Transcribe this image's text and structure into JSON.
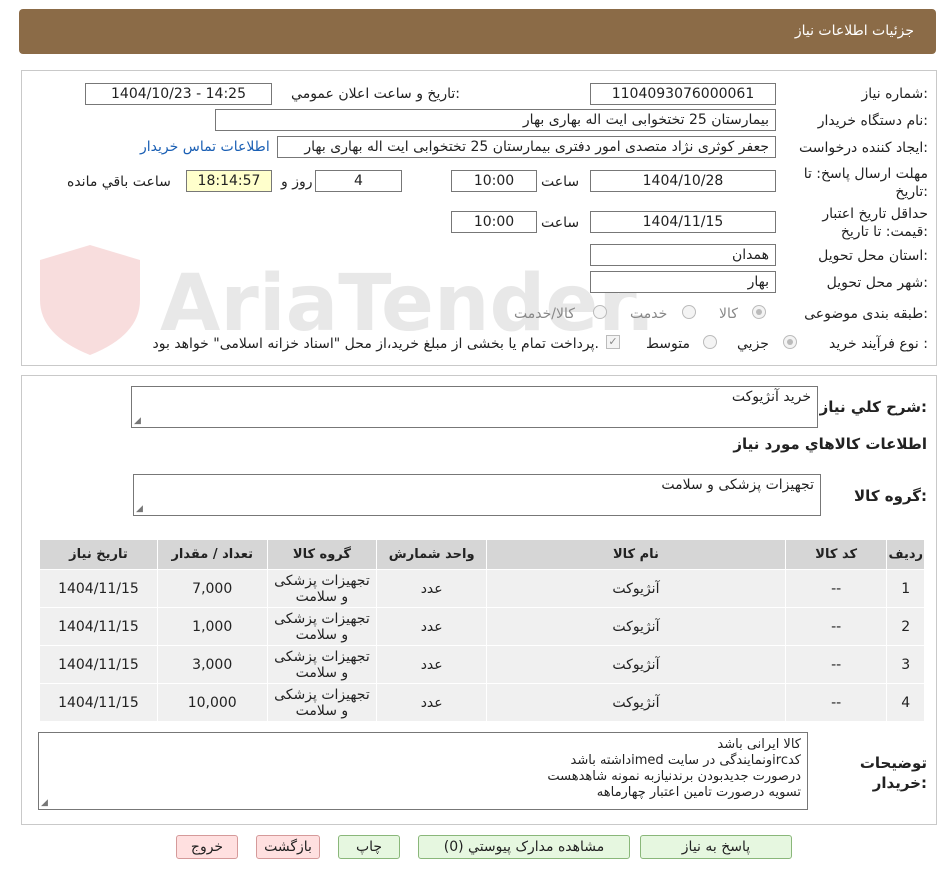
{
  "header": {
    "title": "جزئیات اطلاعات نیاز"
  },
  "watermark": {
    "text": "AriaTender.neT"
  },
  "form": {
    "need_number_label": "شماره نیاز:",
    "need_number": "1104093076000061",
    "announce_label": "تاریخ و ساعت اعلان عمومي:",
    "announce_value": "1404/10/23 - 14:25",
    "buyer_org_label": "نام دستگاه خريدار:",
    "buyer_org": "بیمارستان 25 تختخوابی ایت اله بهاری بهار",
    "creator_label": "ايجاد کننده درخواست:",
    "creator": "جعفر کوثری نژاد متصدی امور دفتری بیمارستان 25 تختخوابی ایت اله بهاری بهار",
    "contact_link": "اطلاعات تماس خریدار",
    "deadline_label": "مهلت ارسال پاسخ: تا تاریخ:",
    "deadline_date": "1404/10/28",
    "time_label": "ساعت",
    "deadline_time": "10:00",
    "days_value": "4",
    "days_label": "روز و",
    "remaining_time": "18:14:57",
    "remaining_label": "ساعت باقي مانده",
    "validity_label": "حداقل تاريخ اعتبار قيمت: تا تاريخ:",
    "validity_date": "1404/11/15",
    "validity_time": "10:00",
    "province_label": "استان محل تحويل:",
    "province": "همدان",
    "city_label": "شهر محل تحويل:",
    "city": "بهار",
    "category_label": "طبقه بندی موضوعی:",
    "category_options": [
      "کالا",
      "خدمت",
      "کالا/خدمت"
    ],
    "process_label": "نوع فرآيند خريد :",
    "process_options": [
      "جزيي",
      "متوسط"
    ],
    "payment_note": "پرداخت تمام یا بخشی از مبلغ خرید،از محل \"اسناد خزانه اسلامی\" خواهد بود."
  },
  "summary": {
    "title_label": "شرح کلي نياز:",
    "title_value": "خرید آنژیوکت",
    "goods_info_heading": "اطلاعات کالاهاي مورد نياز",
    "group_label": "گروه کالا:",
    "group_value": "تجهیزات پزشکی و سلامت"
  },
  "table": {
    "headers": [
      "رديف",
      "کد کالا",
      "نام کالا",
      "واحد شمارش",
      "گروه کالا",
      "تعداد / مقدار",
      "تاريخ نياز"
    ],
    "rows": [
      [
        "1",
        "--",
        "آنژیوکت",
        "عدد",
        "تجهیزات پزشکی و سلامت",
        "7,000",
        "1404/11/15"
      ],
      [
        "2",
        "--",
        "آنژیوکت",
        "عدد",
        "تجهیزات پزشکی و سلامت",
        "1,000",
        "1404/11/15"
      ],
      [
        "3",
        "--",
        "آنژیوکت",
        "عدد",
        "تجهیزات پزشکی و سلامت",
        "3,000",
        "1404/11/15"
      ],
      [
        "4",
        "--",
        "آنژیوکت",
        "عدد",
        "تجهیزات پزشکی و سلامت",
        "10,000",
        "1404/11/15"
      ]
    ]
  },
  "notes": {
    "label": "توضيحات خريدار:",
    "lines": [
      "کالا ایرانی باشد",
      "کدircونمایندگی در سایت imedداشته باشد",
      "درصورت جدیدبودن برندنیازبه نمونه شاهدهست",
      "تسویه درصورت تامین اعتبار چهارماهه"
    ]
  },
  "buttons": {
    "reply": "پاسخ به نياز",
    "attachments": "مشاهده مدارک پيوستي (0)",
    "print": "چاپ",
    "back": "بازگشت",
    "exit": "خروج"
  }
}
